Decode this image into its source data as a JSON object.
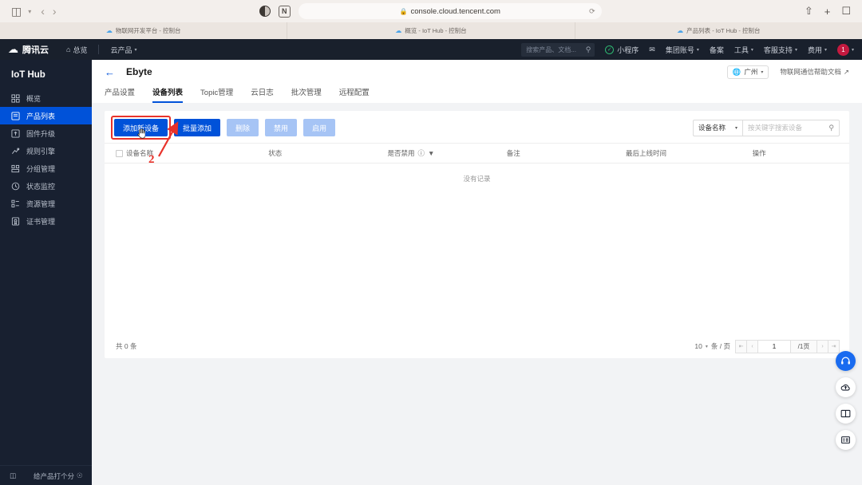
{
  "browser": {
    "url": "console.cloud.tencent.com",
    "lock_icon": "lock-icon",
    "sidebar_toggle_icon": "sidebar-toggle-icon",
    "back_icon": "back-arrow-icon",
    "forward_icon": "forward-arrow-icon",
    "contrast_icon": "reader-contrast-icon",
    "extension_icon": "notion-extension-icon",
    "reload_icon": "reload-icon",
    "share_icon": "share-icon",
    "new_tab_icon": "new-tab-icon",
    "tabs_overview_icon": "tabs-overview-icon",
    "tabs": [
      {
        "title": "物联网开发平台 - 控制台",
        "icon": "cloud-favicon"
      },
      {
        "title": "概览 - IoT Hub - 控制台",
        "icon": "cloud-favicon"
      },
      {
        "title": "产品列表 - IoT Hub - 控制台",
        "icon": "cloud-favicon"
      }
    ]
  },
  "topnav": {
    "brand": "腾讯云",
    "brand_logo_icon": "tencent-cloud-logo-icon",
    "overview_label": "总览",
    "overview_icon": "home-icon",
    "products_label": "云产品",
    "search_placeholder": "搜索产品、文档...",
    "search_icon": "search-icon",
    "miniapp_label": "小程序",
    "mail_icon": "mail-icon",
    "items": [
      {
        "label": "集团账号",
        "caret": true
      },
      {
        "label": "备案",
        "caret": false
      },
      {
        "label": "工具",
        "caret": true
      },
      {
        "label": "客服支持",
        "caret": true
      },
      {
        "label": "费用",
        "caret": true
      }
    ],
    "avatar_text": "1"
  },
  "sidebar": {
    "title": "IoT Hub",
    "items": [
      {
        "label": "概览",
        "icon": "grid-overview-icon",
        "active": false
      },
      {
        "label": "产品列表",
        "icon": "product-list-icon",
        "active": true
      },
      {
        "label": "固件升级",
        "icon": "firmware-upgrade-icon",
        "active": false
      },
      {
        "label": "规则引擎",
        "icon": "rule-engine-icon",
        "active": false
      },
      {
        "label": "分组管理",
        "icon": "group-manage-icon",
        "active": false
      },
      {
        "label": "状态监控",
        "icon": "status-monitor-icon",
        "active": false
      },
      {
        "label": "资源管理",
        "icon": "resource-manage-icon",
        "active": false
      },
      {
        "label": "证书管理",
        "icon": "certificate-icon",
        "active": false
      }
    ],
    "footer": {
      "collapse_icon": "collapse-sidebar-icon",
      "rate_label": "给产品打个分",
      "rate_icon": "smiley-icon"
    }
  },
  "page": {
    "back_icon": "back-arrow-icon",
    "title": "Ebyte",
    "region": {
      "label": "广州",
      "icon": "globe-icon",
      "caret_icon": "chevron-down-icon"
    },
    "help_link": {
      "label": "物联网通信帮助文档",
      "icon": "external-link-icon"
    },
    "tabs": [
      {
        "label": "产品设置",
        "active": false
      },
      {
        "label": "设备列表",
        "active": true
      },
      {
        "label": "Topic管理",
        "active": false
      },
      {
        "label": "云日志",
        "active": false
      },
      {
        "label": "批次管理",
        "active": false
      },
      {
        "label": "远程配置",
        "active": false
      }
    ]
  },
  "toolbar": {
    "add_device_label": "添加新设备",
    "batch_add_label": "批量添加",
    "delete_label": "删除",
    "disable_label": "禁用",
    "enable_label": "启用",
    "filter_field_label": "设备名称",
    "filter_caret_icon": "chevron-down-icon",
    "search_placeholder": "按关键字搜索设备",
    "search_icon": "search-icon",
    "cursor_icon": "hand-cursor-icon"
  },
  "table": {
    "select_all_icon": "checkbox-icon",
    "columns": [
      {
        "label": "设备名称",
        "checkbox": true
      },
      {
        "label": "状态"
      },
      {
        "label": "是否禁用",
        "info_icon": "info-icon",
        "filter_icon": "filter-icon"
      },
      {
        "label": "备注"
      },
      {
        "label": "最后上线时间"
      },
      {
        "label": "操作"
      }
    ],
    "rows": [],
    "empty_text": "没有记录"
  },
  "footer": {
    "total_label": "共 0 条",
    "page_size": "10",
    "page_size_caret_icon": "chevron-down-icon",
    "page_size_unit": "条 / 页",
    "first_page_icon": "first-page-icon",
    "prev_page_icon": "prev-page-icon",
    "current_page": "1",
    "total_pages": "/1页",
    "next_page_icon": "next-page-icon",
    "last_page_icon": "last-page-icon"
  },
  "annotation": {
    "step_number": "2",
    "highlight_color": "#e8322a"
  },
  "rail": [
    {
      "icon": "headset-support-icon",
      "primary": true
    },
    {
      "icon": "cloud-upload-icon",
      "primary": false
    },
    {
      "icon": "book-docs-icon",
      "primary": false
    },
    {
      "icon": "list-menu-icon",
      "primary": false
    }
  ]
}
